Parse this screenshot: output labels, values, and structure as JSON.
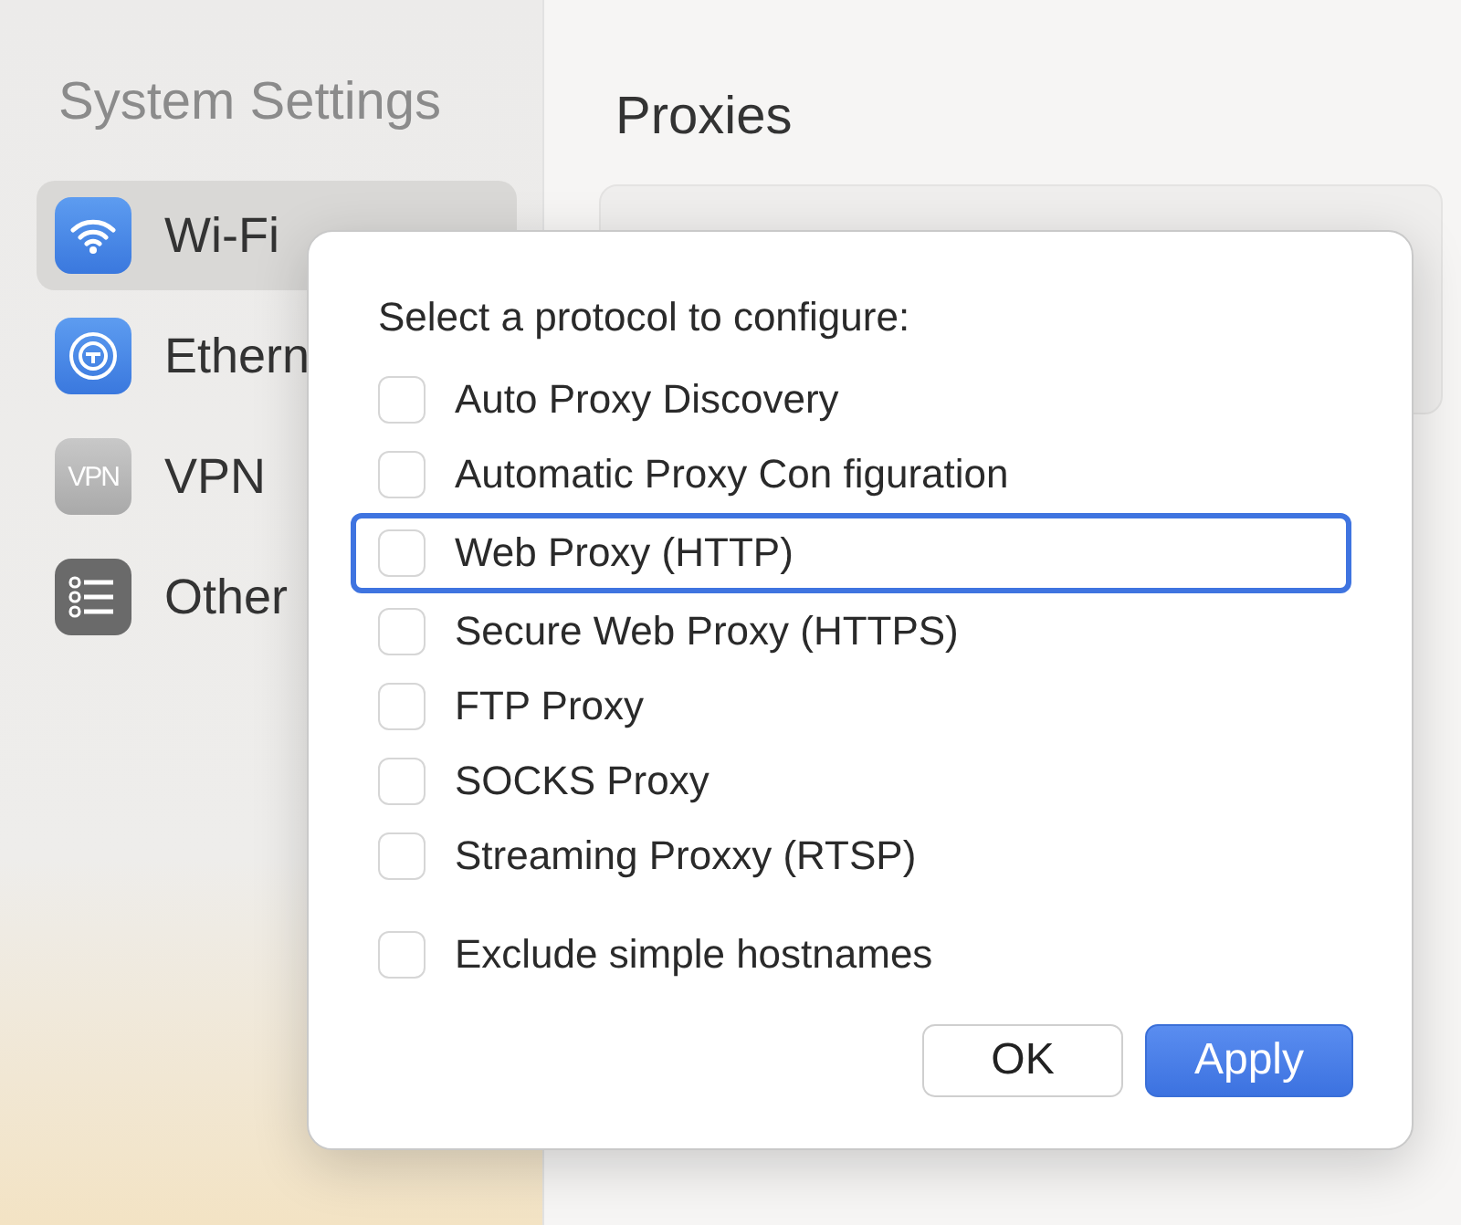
{
  "sidebar": {
    "title": "System Settings",
    "items": [
      {
        "label": "Wi-Fi",
        "kind": "wifi",
        "selected": true
      },
      {
        "label": "Ethern",
        "kind": "ethernet",
        "selected": false
      },
      {
        "label": "VPN",
        "kind": "vpn",
        "icon_text": "VPN",
        "selected": false
      },
      {
        "label": "Other",
        "kind": "list",
        "selected": false
      }
    ]
  },
  "main": {
    "title": "Proxies"
  },
  "dialog": {
    "heading": "Select a protocol to configure:",
    "options": [
      {
        "label": "Auto Proxy Discovery",
        "checked": false,
        "focused": false
      },
      {
        "label": "Automatic Proxy Con figuration",
        "checked": false,
        "focused": false
      },
      {
        "label": "Web Proxy (HTTP)",
        "checked": false,
        "focused": true
      },
      {
        "label": "Secure Web Proxy (HTTPS)",
        "checked": false,
        "focused": false
      },
      {
        "label": "FTP Proxy",
        "checked": false,
        "focused": false
      },
      {
        "label": "SOCKS Proxy",
        "checked": false,
        "focused": false
      },
      {
        "label": "Streaming Proxxy (RTSP)",
        "checked": false,
        "focused": false
      }
    ],
    "exclude": {
      "label": "Exclude simple hostnames",
      "checked": false
    },
    "buttons": [
      {
        "label": "OK",
        "kind": "default"
      },
      {
        "label": "Apply",
        "kind": "primary"
      }
    ]
  }
}
